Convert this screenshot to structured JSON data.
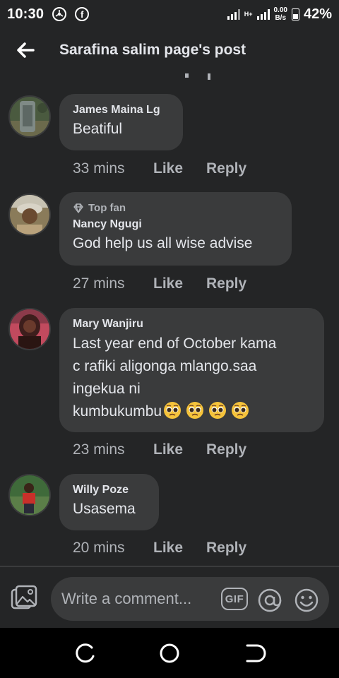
{
  "status_bar": {
    "time": "10:30",
    "network_label": "H+",
    "speed_value": "0.00",
    "speed_unit": "B/s",
    "battery": "42%",
    "icons": [
      "chrome-icon",
      "facebook-icon",
      "signal-icon",
      "battery-icon"
    ]
  },
  "header": {
    "title": "Sarafina salim page's post",
    "back_icon": "arrow-left-icon"
  },
  "comments": [
    {
      "author": "James Maina Lg",
      "text": "Beatiful",
      "time": "33 mins",
      "like": "Like",
      "reply": "Reply"
    },
    {
      "badge": "Top fan",
      "author": "Nancy Ngugi",
      "text": "God help us all wise advise",
      "time": "27 mins",
      "like": "Like",
      "reply": "Reply"
    },
    {
      "author": "Mary Wanjiru",
      "text_lines": [
        "Last year  end of October kama",
        "c rafiki aligonga mlango.saa",
        "ingekua ni",
        "kumbukumbu"
      ],
      "emoji": "pleading-face-emoji x4",
      "time": "23 mins",
      "like": "Like",
      "reply": "Reply"
    },
    {
      "author": "Willy Poze",
      "text": "Usasema",
      "time": "20 mins",
      "like": "Like",
      "reply": "Reply"
    }
  ],
  "composer": {
    "placeholder": "Write a comment...",
    "gif_label": "GIF",
    "icons": [
      "photo-icon",
      "gif-icon",
      "mention-icon",
      "emoji-icon"
    ]
  },
  "nav_bar": {
    "icons": [
      "recents-icon",
      "home-icon",
      "back-icon"
    ]
  },
  "colors": {
    "background": "#242526",
    "bubble": "#3a3b3c",
    "primary_text": "#e4e6eb",
    "secondary_text": "#b0b3b8",
    "nav_bar": "#000000"
  }
}
